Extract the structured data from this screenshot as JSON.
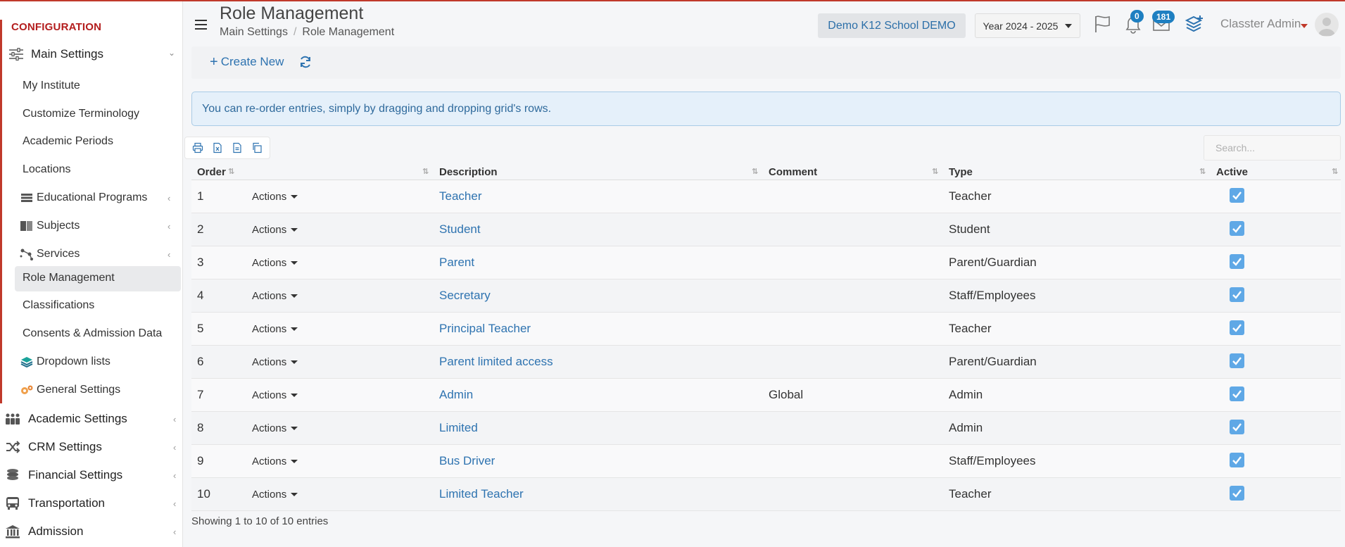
{
  "sidebar": {
    "section_title": "CONFIGURATION",
    "main_settings": "Main Settings",
    "sub_items": [
      {
        "label": "My Institute",
        "icon": "",
        "chevron": false
      },
      {
        "label": "Customize Terminology",
        "icon": "",
        "chevron": false
      },
      {
        "label": "Academic Periods",
        "icon": "",
        "chevron": false
      },
      {
        "label": "Locations",
        "icon": "",
        "chevron": false
      },
      {
        "label": "Educational Programs",
        "icon": "list-icon",
        "chevron": true
      },
      {
        "label": "Subjects",
        "icon": "book-icon",
        "chevron": true
      },
      {
        "label": "Services",
        "icon": "network-icon",
        "chevron": true
      },
      {
        "label": "Role Management",
        "icon": "",
        "chevron": false,
        "active": true
      },
      {
        "label": "Classifications",
        "icon": "",
        "chevron": false
      },
      {
        "label": "Consents & Admission Data",
        "icon": "",
        "chevron": false
      },
      {
        "label": "Dropdown lists",
        "icon": "layers-icon",
        "chevron": false
      },
      {
        "label": "General Settings",
        "icon": "gears-icon",
        "chevron": false
      }
    ],
    "categories": [
      {
        "label": "Academic Settings",
        "icon": "users-icon"
      },
      {
        "label": "CRM Settings",
        "icon": "shuffle-icon"
      },
      {
        "label": "Financial Settings",
        "icon": "coins-icon"
      },
      {
        "label": "Transportation",
        "icon": "bus-icon"
      },
      {
        "label": "Admission",
        "icon": "bank-icon"
      }
    ]
  },
  "header": {
    "title": "Role Management",
    "breadcrumb": [
      "Main Settings",
      "Role Management"
    ],
    "school": "Demo K12 School DEMO",
    "year": "Year 2024 - 2025",
    "notifications_count": "0",
    "messages_count": "181",
    "user_name": "Classter Admin"
  },
  "toolbar": {
    "create_new": "Create New"
  },
  "info_message": "You can re-order entries, simply by dragging and dropping grid's rows.",
  "search": {
    "placeholder": "Search..."
  },
  "table": {
    "columns": [
      "Order",
      "",
      "Description",
      "Comment",
      "Type",
      "Active"
    ],
    "actions_label": "Actions",
    "rows": [
      {
        "order": "1",
        "description": "Teacher",
        "comment": "",
        "type": "Teacher",
        "active": true
      },
      {
        "order": "2",
        "description": "Student",
        "comment": "",
        "type": "Student",
        "active": true
      },
      {
        "order": "3",
        "description": "Parent",
        "comment": "",
        "type": "Parent/Guardian",
        "active": true
      },
      {
        "order": "4",
        "description": "Secretary",
        "comment": "",
        "type": "Staff/Employees",
        "active": true
      },
      {
        "order": "5",
        "description": "Principal Teacher",
        "comment": "",
        "type": "Teacher",
        "active": true
      },
      {
        "order": "6",
        "description": "Parent limited access",
        "comment": "",
        "type": "Parent/Guardian",
        "active": true
      },
      {
        "order": "7",
        "description": "Admin",
        "comment": "Global",
        "type": "Admin",
        "active": true
      },
      {
        "order": "8",
        "description": "Limited",
        "comment": "",
        "type": "Admin",
        "active": true
      },
      {
        "order": "9",
        "description": "Bus Driver",
        "comment": "",
        "type": "Staff/Employees",
        "active": true
      },
      {
        "order": "10",
        "description": "Limited Teacher",
        "comment": "",
        "type": "Teacher",
        "active": true
      }
    ]
  },
  "footer": {
    "info": "Showing 1 to 10 of 10 entries"
  },
  "colors": {
    "accent": "#2e73b0",
    "brand_red": "#c0392b",
    "checkbox": "#5fa8e6"
  }
}
